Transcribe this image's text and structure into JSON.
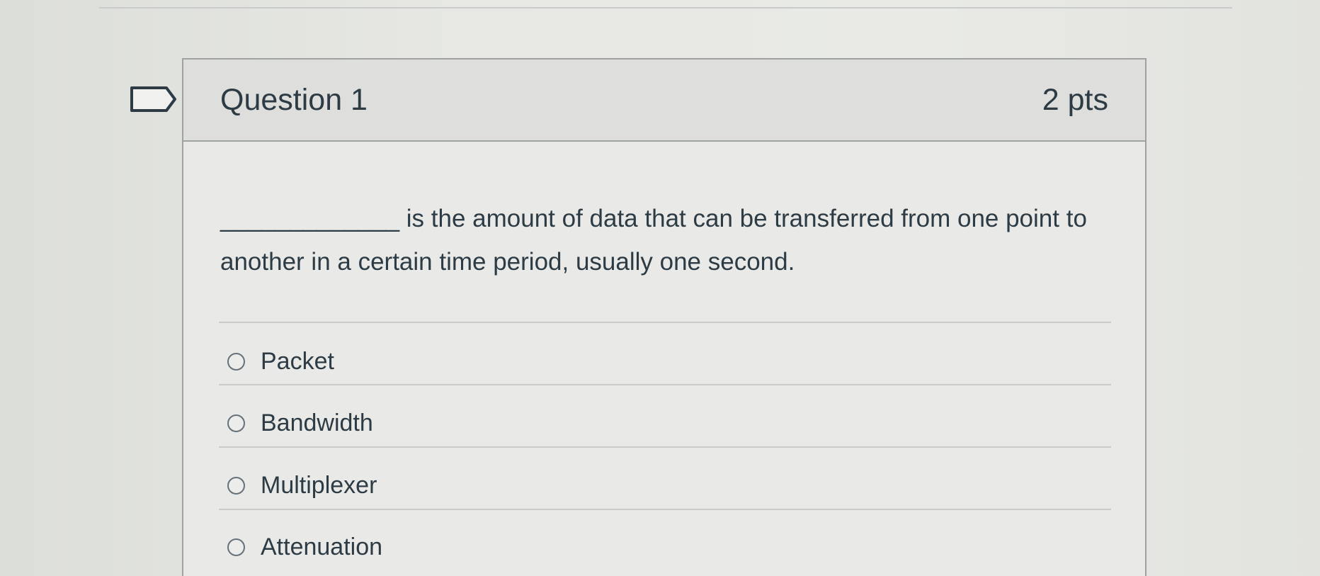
{
  "question": {
    "title": "Question 1",
    "points": "2 pts",
    "text": "_____________ is the amount of data that can be transferred from one point to another in a certain time period, usually one second."
  },
  "answers": [
    {
      "label": "Packet"
    },
    {
      "label": "Bandwidth"
    },
    {
      "label": "Multiplexer"
    },
    {
      "label": "Attenuation"
    }
  ],
  "icons": {
    "flag": "flag-question-icon",
    "radio": "radio-button-icon"
  },
  "colors": {
    "text": "#2d3b45",
    "border": "#9ea3a2",
    "header_bg": "#dedfdc"
  }
}
